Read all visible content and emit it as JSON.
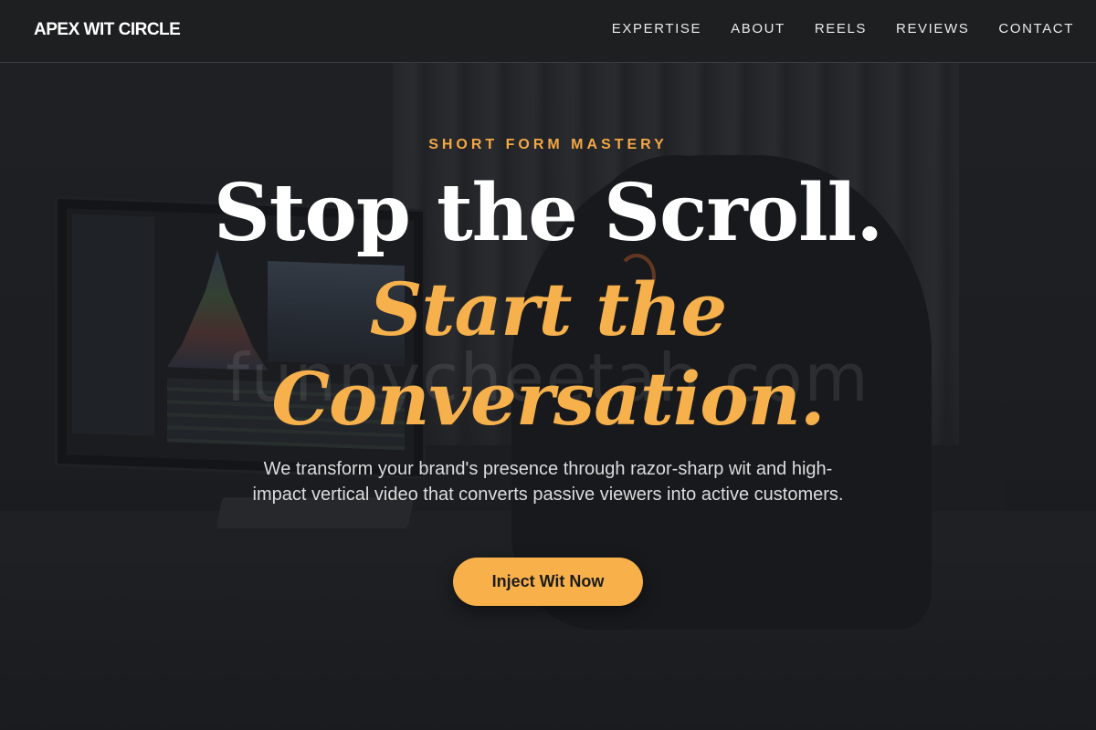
{
  "navbar": {
    "logo": "APEX WIT CIRCLE",
    "links": [
      "EXPERTISE",
      "ABOUT",
      "REELS",
      "REVIEWS",
      "CONTACT"
    ]
  },
  "hero": {
    "eyebrow": "SHORT FORM MASTERY",
    "headline": "Stop the Scroll.",
    "headline_accent_line1": "Start the",
    "headline_accent_line2": "Conversation.",
    "subtext": "We transform your brand's presence through razor-sharp wit and high-impact vertical video that converts passive viewers into active customers.",
    "cta_label": "Inject Wit Now"
  },
  "watermark": "funnycheetah.com",
  "colors": {
    "accent": "#f6b04c",
    "button": "#f8b14a",
    "navbar_bg": "#1e1f21",
    "page_bg": "#1d1f22"
  },
  "icons": []
}
